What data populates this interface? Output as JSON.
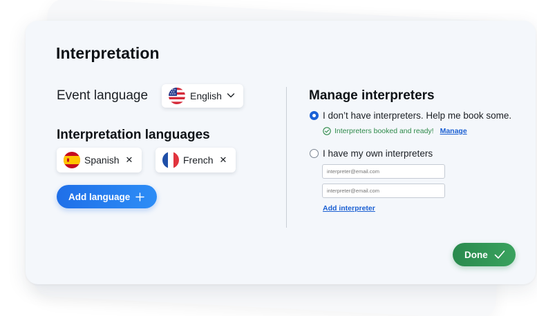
{
  "dialog": {
    "title": "Interpretation"
  },
  "event_language": {
    "label": "Event language",
    "selected": "English",
    "flag_icon": "us-flag-icon"
  },
  "interpretation_languages": {
    "heading": "Interpretation languages",
    "chips": [
      {
        "label": "Spanish",
        "flag_icon": "spain-flag-icon",
        "remove_glyph": "✕"
      },
      {
        "label": "French",
        "flag_icon": "france-flag-icon",
        "remove_glyph": "✕"
      }
    ],
    "add_button_label": "Add language",
    "add_button_icon": "plus-icon"
  },
  "manage_interpreters": {
    "heading": "Manage interpreters",
    "options": [
      {
        "label": "I don’t have interpreters. Help me book some.",
        "checked": true
      },
      {
        "label": "I have my own interpreters",
        "checked": false
      }
    ],
    "booked_status": "Interpreters booked and ready!",
    "manage_link": "Manage",
    "email_placeholders": [
      "interpreter@email.com",
      "interpreter@email.com"
    ],
    "add_interpreter_link": "Add interpreter"
  },
  "footer": {
    "done_label": "Done",
    "done_icon": "checkmark-icon"
  },
  "colors": {
    "primary_blue": "#1f6fe8",
    "success_green": "#2e8a4a",
    "done_green": "#2a8a4e",
    "card_bg": "#f4f7fb"
  }
}
